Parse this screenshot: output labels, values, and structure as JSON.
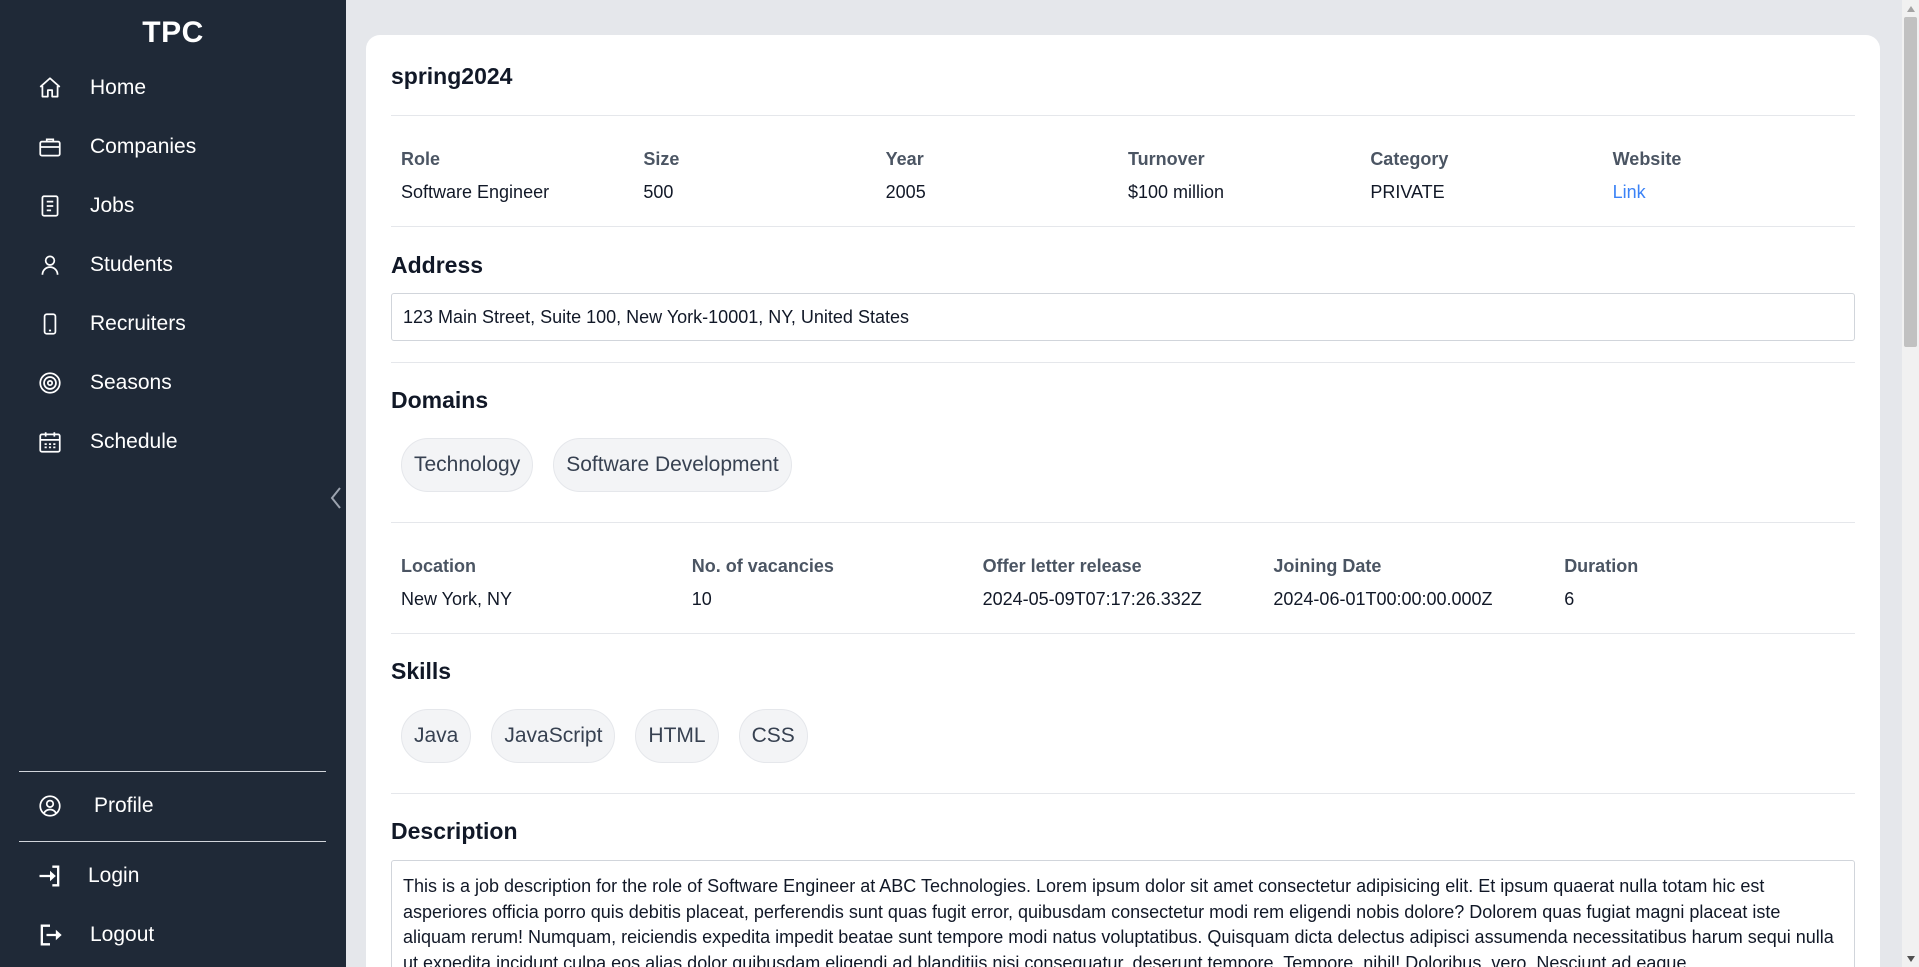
{
  "sidebar": {
    "brand": "TPC",
    "items": [
      {
        "label": "Home",
        "icon": "home-icon"
      },
      {
        "label": "Companies",
        "icon": "briefcase-icon"
      },
      {
        "label": "Jobs",
        "icon": "document-icon"
      },
      {
        "label": "Students",
        "icon": "user-icon"
      },
      {
        "label": "Recruiters",
        "icon": "phone-icon"
      },
      {
        "label": "Seasons",
        "icon": "target-icon"
      },
      {
        "label": "Schedule",
        "icon": "calendar-icon"
      }
    ],
    "profile": "Profile",
    "login": "Login",
    "logout": "Logout"
  },
  "job": {
    "title": "spring2024",
    "summary": [
      {
        "key": "Role",
        "value": "Software Engineer"
      },
      {
        "key": "Size",
        "value": "500"
      },
      {
        "key": "Year",
        "value": "2005"
      },
      {
        "key": "Turnover",
        "value": "$100 million"
      },
      {
        "key": "Category",
        "value": "PRIVATE"
      },
      {
        "key": "Website",
        "value": "Link"
      }
    ],
    "address_title": "Address",
    "address": "123 Main Street, Suite 100, New York-10001, NY, United States",
    "domains_title": "Domains",
    "domains": [
      "Technology",
      "Software Development"
    ],
    "details": [
      {
        "key": "Location",
        "value": "New York, NY"
      },
      {
        "key": "No. of vacancies",
        "value": "10"
      },
      {
        "key": "Offer letter release",
        "value": "2024-05-09T07:17:26.332Z"
      },
      {
        "key": "Joining Date",
        "value": "2024-06-01T00:00:00.000Z"
      },
      {
        "key": "Duration",
        "value": "6"
      }
    ],
    "skills_title": "Skills",
    "skills": [
      "Java",
      "JavaScript",
      "HTML",
      "CSS"
    ],
    "description_title": "Description",
    "description": "This is a job description for the role of Software Engineer at ABC Technologies. Lorem ipsum dolor sit amet consectetur adipisicing elit. Et ipsum quaerat nulla totam hic est asperiores officia porro quis debitis placeat, perferendis sunt quas fugit error, quibusdam consectetur modi rem eligendi nobis dolore? Dolorem quas fugiat magni placeat iste aliquam rerum! Numquam, reiciendis expedita impedit beatae sunt tempore modi natus voluptatibus. Quisquam dicta delectus adipisci assumenda necessitatibus harum sequi nulla ut expedita incidunt culpa eos alias dolor quibusdam eligendi ad blanditiis nisi consequatur, deserunt tempore. Tempore, nihil! Doloribus, vero. Nesciunt ad eaque"
  },
  "colors": {
    "sidebar_bg": "#1f2937",
    "page_bg": "#e5e7eb",
    "link": "#3b82f6"
  }
}
